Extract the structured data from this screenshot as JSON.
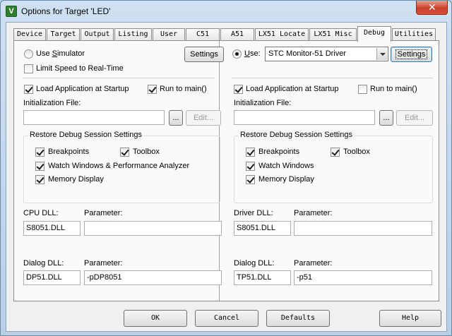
{
  "window": {
    "title": "Options for Target 'LED'",
    "close_glyph": "✕"
  },
  "tabs": [
    {
      "label": "Device"
    },
    {
      "label": "Target"
    },
    {
      "label": "Output"
    },
    {
      "label": "Listing"
    },
    {
      "label": "User"
    },
    {
      "label": "C51"
    },
    {
      "label": "A51"
    },
    {
      "label": "LX51 Locate"
    },
    {
      "label": "LX51 Misc"
    },
    {
      "label": "Debug"
    },
    {
      "label": "Utilities"
    }
  ],
  "active_tab": "Debug",
  "left": {
    "use_simulator_prefix": "Use ",
    "use_simulator_accel": "S",
    "use_simulator_rest": "imulator",
    "settings_label": "Settings",
    "limit_speed_label": "Limit Speed to Real-Time",
    "load_app_label": "Load Application at Startup",
    "run_to_main_label": "Run to main()",
    "init_file_label": "Initialization File:",
    "init_file_value": "",
    "browse_label": "...",
    "edit_label": "Edit...",
    "restore_group_label": "Restore Debug Session Settings",
    "breakpoints_label": "Breakpoints",
    "toolbox_label": "Toolbox",
    "watch_label": "Watch Windows & Performance Analyzer",
    "memory_label": "Memory Display",
    "dll_label": "CPU DLL:",
    "dll_param_label": "Parameter:",
    "dll_value": "S8051.DLL",
    "dll_param_value": "",
    "dialog_dll_label": "Dialog DLL:",
    "dialog_param_label": "Parameter:",
    "dialog_dll_value": "DP51.DLL",
    "dialog_param_value": "-pDP8051"
  },
  "right": {
    "use_label_accel": "U",
    "use_label_rest": "se:",
    "driver_selected": "STC Monitor-51 Driver",
    "settings_label": "Settings",
    "load_app_label": "Load Application at Startup",
    "run_to_main_label": "Run to main()",
    "init_file_label": "Initialization File:",
    "init_file_value": "",
    "browse_label": "...",
    "edit_label": "Edit...",
    "restore_group_label": "Restore Debug Session Settings",
    "breakpoints_label": "Breakpoints",
    "toolbox_label": "Toolbox",
    "watch_label": "Watch Windows",
    "memory_label": "Memory Display",
    "dll_label": "Driver DLL:",
    "dll_param_label": "Parameter:",
    "dll_value": "S8051.DLL",
    "dll_param_value": "",
    "dialog_dll_label": "Dialog DLL:",
    "dialog_param_label": "Parameter:",
    "dialog_dll_value": "TP51.DLL",
    "dialog_param_value": "-p51"
  },
  "footer": {
    "ok_label": "OK",
    "cancel_label": "Cancel",
    "defaults_label": "Defaults",
    "help_label": "Help"
  }
}
